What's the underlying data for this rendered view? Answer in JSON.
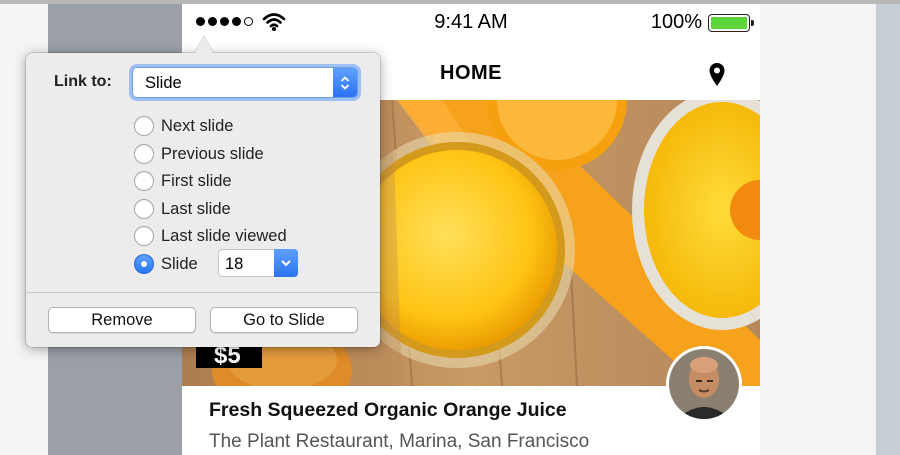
{
  "statusbar": {
    "time": "9:41 AM",
    "battery_percent": "100%",
    "signal_bars_filled": 4,
    "signal_bars_total": 5,
    "icons": [
      "signal-dots-icon",
      "wifi-icon",
      "battery-icon"
    ]
  },
  "navbar": {
    "title": "HOME",
    "right_icon": "location-pin-icon"
  },
  "card": {
    "price": "$5",
    "title": "Fresh Squeezed Organic Orange Juice",
    "subtitle": "The Plant Restaurant, Marina, San Francisco"
  },
  "popover": {
    "link_to_label": "Link to:",
    "link_to_value": "Slide",
    "options": [
      {
        "label": "Next slide",
        "selected": false
      },
      {
        "label": "Previous slide",
        "selected": false
      },
      {
        "label": "First slide",
        "selected": false
      },
      {
        "label": "Last slide",
        "selected": false
      },
      {
        "label": "Last slide viewed",
        "selected": false
      },
      {
        "label": "Slide",
        "selected": true
      }
    ],
    "slide_number": "18",
    "remove_label": "Remove",
    "goto_label": "Go to Slide"
  },
  "colors": {
    "accent": "#2b73f0",
    "battery": "#5cd43c",
    "orange": "#f7a21c"
  }
}
